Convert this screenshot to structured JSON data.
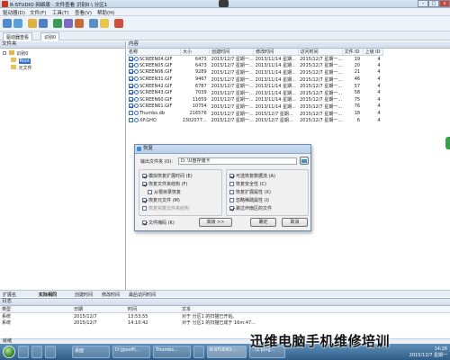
{
  "window": {
    "title": "R-STUDIO 网络版 · 文件查看 识别0 \\ 分区1",
    "buttons": {
      "minimize": "–",
      "maximize": "□",
      "close": "x"
    }
  },
  "menu": [
    "驱动器(D)",
    "文件(F)",
    "工具(T)",
    "查看(V)",
    "帮助(H)"
  ],
  "tabs": [
    "驱动器查看",
    "识别0"
  ],
  "folders": {
    "header": "文件夹",
    "tree": [
      "识别0",
      "Root",
      "元文件"
    ]
  },
  "contents": {
    "header": "内容",
    "columns": [
      "名称",
      "大小",
      "创建时间",
      "修改时间",
      "访问时间",
      "文件 ID",
      "上级 ID"
    ],
    "rows": [
      {
        "name": "SCREEN04.GIF",
        "size": "6473",
        "created": "2015/12/7 星期一...",
        "modified": "2013/11/14 星期...",
        "accessed": "2015/12/7 星期一...",
        "id": "19",
        "parent": "4"
      },
      {
        "name": "SCREEN05.GIF",
        "size": "6473",
        "created": "2015/12/7 星期一...",
        "modified": "2013/11/14 星期...",
        "accessed": "2015/12/7 星期一...",
        "id": "20",
        "parent": "4"
      },
      {
        "name": "SCREEN06.GIF",
        "size": "9289",
        "created": "2015/12/7 星期一...",
        "modified": "2013/11/14 星期...",
        "accessed": "2015/12/7 星期一...",
        "id": "21",
        "parent": "4"
      },
      {
        "name": "SCREEN31.GIF",
        "size": "9467",
        "created": "2015/12/7 星期一...",
        "modified": "2013/11/14 星期...",
        "accessed": "2015/12/7 星期一...",
        "id": "46",
        "parent": "4"
      },
      {
        "name": "SCREEN42.GIF",
        "size": "6787",
        "created": "2015/12/7 星期一...",
        "modified": "2013/11/14 星期...",
        "accessed": "2015/12/7 星期一...",
        "id": "57",
        "parent": "4"
      },
      {
        "name": "SCREEN43.GIF",
        "size": "7039",
        "created": "2015/12/7 星期一...",
        "modified": "2013/11/14 星期...",
        "accessed": "2015/12/7 星期一...",
        "id": "58",
        "parent": "4"
      },
      {
        "name": "SCREEN60.GIF",
        "size": "11659",
        "created": "2015/12/7 星期一...",
        "modified": "2013/11/14 星期...",
        "accessed": "2015/12/7 星期一...",
        "id": "75",
        "parent": "4"
      },
      {
        "name": "SCREEN61.GIF",
        "size": "10754",
        "created": "2015/12/7 星期一...",
        "modified": "2013/11/14 星期...",
        "accessed": "2015/12/7 星期一...",
        "id": "76",
        "parent": "4"
      },
      {
        "name": "Thumbs.db",
        "size": "216576",
        "created": "2015/12/7 星期一...",
        "modified": "2015/12/7 星期...",
        "accessed": "2015/12/7 星期一...",
        "id": "18",
        "parent": "4"
      },
      {
        "name": "XP.GHO",
        "size": "1302077...",
        "created": "2015/12/7 星期一...",
        "modified": "2015/12/7 星期...",
        "accessed": "2015/12/7 星期一...",
        "id": "6",
        "parent": "4"
      }
    ]
  },
  "dialog": {
    "title": "恢复",
    "output_label": "输出文件夹 (O):",
    "output_value": "D: \\U盘存储卡",
    "options_left": [
      "模拟恢复扩展时间 (E)",
      "恢复文件夹结构 (F)",
      "从根目录恢复",
      "恢复元文件 (M)",
      "恢复实数文件夹结构"
    ],
    "options_right": [
      "可选恢复数据流 (A)",
      "恢复安全性 (C)",
      "恢复扩展属性 (X)",
      "忽略稀疏属性 (I)",
      "跳过坏扇区的文件"
    ],
    "mask_label": "文件掩码 (K)",
    "buttons": {
      "advanced": "高级 >>",
      "ok": "确定",
      "cancel": "取消"
    }
  },
  "bottom_tabs": [
    "扩展名",
    "实际相同",
    "创建时间",
    "修改时间",
    "最后访问时间"
  ],
  "log": {
    "header": "日志",
    "columns": [
      "类型",
      "日期",
      "时间",
      "文本"
    ],
    "rows": [
      {
        "type": "系统",
        "date": "2015/12/7",
        "time": "13:53:55",
        "text": "对于 分区1 的扫描已开始。"
      },
      {
        "type": "系统",
        "date": "2015/12/7",
        "time": "14:10:42",
        "text": "对于 分区1 的扫描已成于 16m:47... "
      }
    ]
  },
  "status": "就绪",
  "taskbar": {
    "items": [
      "桌面",
      "D:\\Jpsoft\\...",
      "Thumbs...",
      "",
      "R-STUDIO...",
      "..\\1 ping..."
    ],
    "clock_time": "14:26",
    "clock_date": "2015/12/7 星期一"
  },
  "watermark": "迅维电脑手机维修培训",
  "colors": {
    "accent": "#2d6fd1",
    "titlebar": "#c4d5ea",
    "close": "#c9483a",
    "taskbar": "#2f5d87"
  }
}
